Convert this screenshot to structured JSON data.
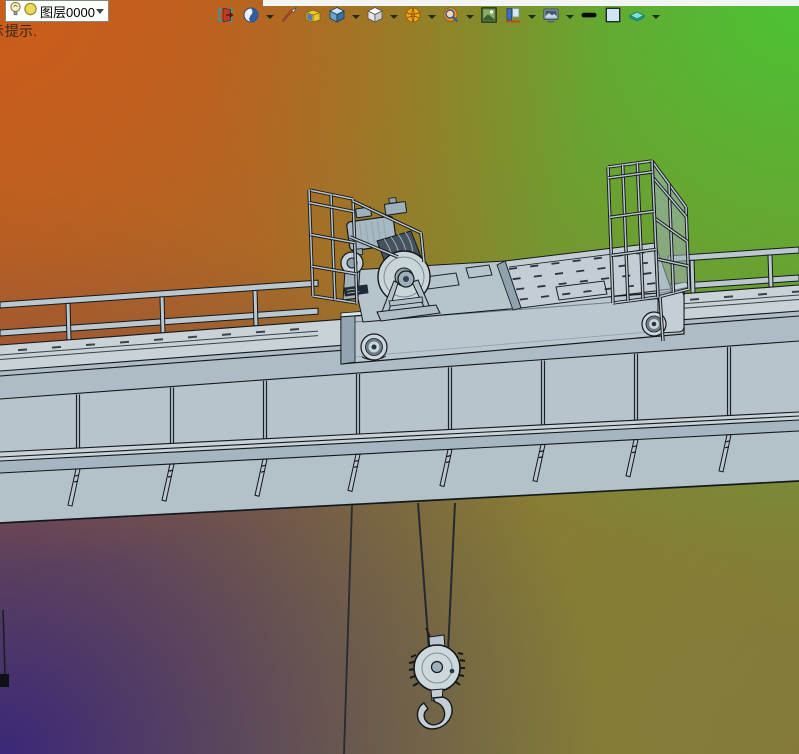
{
  "top_bar": {
    "hint_text": "提示."
  },
  "toolbar": {
    "buttons": [
      {
        "name": "exit-door",
        "dropdown": false
      },
      {
        "name": "render-environment",
        "dropdown": true
      },
      {
        "name": "paint-brush",
        "dropdown": false
      },
      {
        "name": "material-bucket",
        "dropdown": false
      },
      {
        "name": "shaded-cube",
        "dropdown": true
      },
      {
        "name": "white-cube",
        "dropdown": true
      },
      {
        "name": "segmented-sphere",
        "dropdown": true
      },
      {
        "name": "zoom-search",
        "dropdown": true
      },
      {
        "name": "scene-view",
        "dropdown": false
      },
      {
        "name": "window-layout",
        "dropdown": true
      },
      {
        "name": "display-monitor",
        "dropdown": true
      },
      {
        "name": "line-width",
        "dropdown": false
      },
      {
        "name": "background-color",
        "dropdown": false
      },
      {
        "name": "layer-color",
        "dropdown": true
      }
    ]
  },
  "layer_combo": {
    "value": "图层0000",
    "icons": [
      "bulb-icon",
      "layer-circle-icon"
    ]
  },
  "colors": {
    "bg_top_left": "#cc5c1a",
    "bg_top_right": "#4cc233",
    "bg_bottom_left": "#3a2878",
    "bg_bottom_right": "#84793a",
    "model_fill": "#b9c6cd",
    "model_outline": "#14181c",
    "top_strip": "#f2f4f5"
  }
}
